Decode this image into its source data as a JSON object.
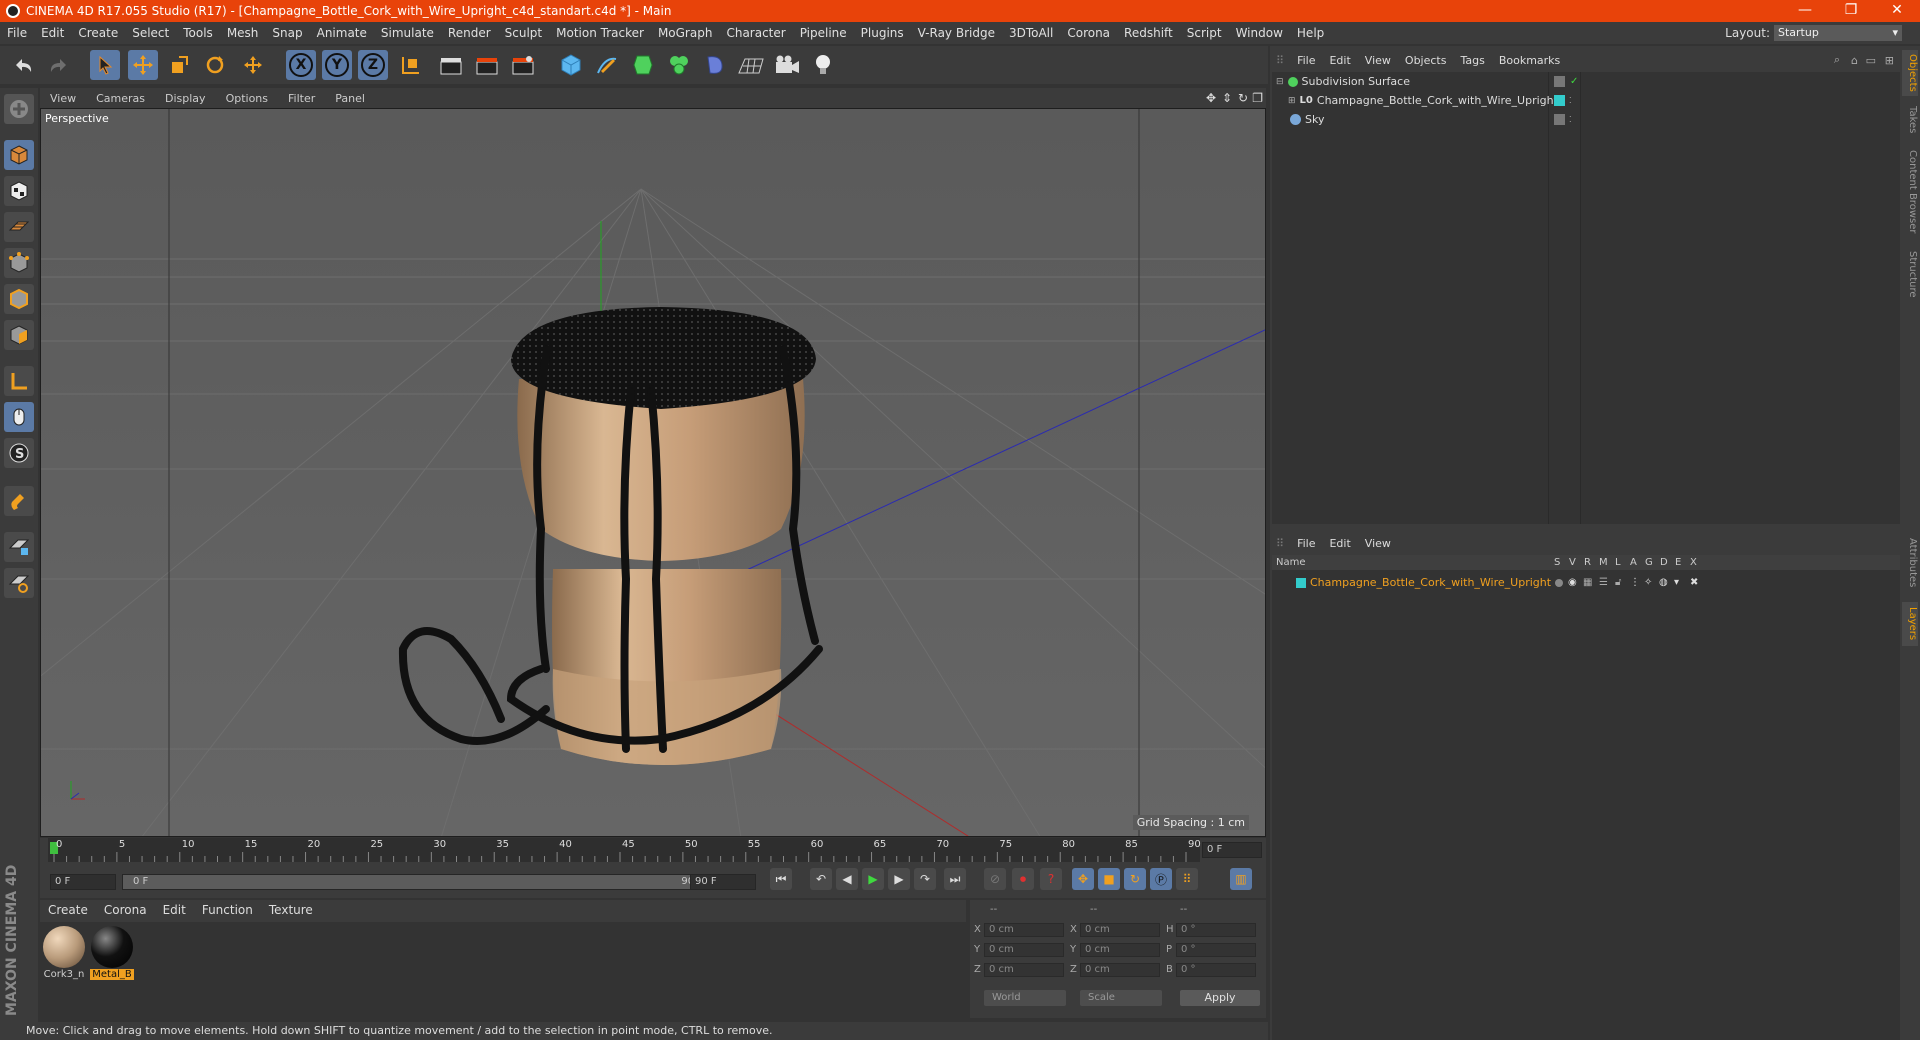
{
  "window": {
    "title": "CINEMA 4D R17.055 Studio (R17) - [Champagne_Bottle_Cork_with_Wire_Upright_c4d_standart.c4d *] - Main",
    "minimize": "—",
    "restore": "❐",
    "close": "✕"
  },
  "menubar": {
    "items": [
      "File",
      "Edit",
      "Create",
      "Select",
      "Tools",
      "Mesh",
      "Snap",
      "Animate",
      "Simulate",
      "Render",
      "Sculpt",
      "Motion Tracker",
      "MoGraph",
      "Character",
      "Pipeline",
      "Plugins",
      "V-Ray Bridge",
      "3DToAll",
      "Corona",
      "Redshift",
      "Script",
      "Window",
      "Help"
    ],
    "layout_label": "Layout:",
    "layout_value": "Startup"
  },
  "toolbar": {
    "axis_x": "X",
    "axis_y": "Y",
    "axis_z": "Z"
  },
  "viewport": {
    "menu": [
      "View",
      "Cameras",
      "Display",
      "Options",
      "Filter",
      "Panel"
    ],
    "label": "Perspective",
    "grid_spacing": "Grid Spacing : 1 cm"
  },
  "timeline": {
    "ticks": [
      "0",
      "5",
      "10",
      "15",
      "20",
      "25",
      "30",
      "35",
      "40",
      "45",
      "50",
      "55",
      "60",
      "65",
      "70",
      "75",
      "80",
      "85",
      "90"
    ],
    "end_frame": "0 F",
    "current_frame": "0 F",
    "range_start": "0 F",
    "range_end": "90 F",
    "max_frame": "90 F"
  },
  "material_manager": {
    "menu": [
      "Create",
      "Corona",
      "Edit",
      "Function",
      "Texture"
    ],
    "materials": [
      {
        "name": "Cork3_n",
        "color": "#b89a7a"
      },
      {
        "name": "Metal_B",
        "color": "#111111"
      }
    ]
  },
  "coordinates": {
    "header": [
      "--",
      "--",
      "--"
    ],
    "rows": [
      {
        "a": "X",
        "av": "0 cm",
        "b": "X",
        "bv": "0 cm",
        "c": "H",
        "cv": "0 °"
      },
      {
        "a": "Y",
        "av": "0 cm",
        "b": "Y",
        "bv": "0 cm",
        "c": "P",
        "cv": "0 °"
      },
      {
        "a": "Z",
        "av": "0 cm",
        "b": "Z",
        "bv": "0 cm",
        "c": "B",
        "cv": "0 °"
      }
    ],
    "mode1": "World",
    "mode2": "Scale",
    "apply": "Apply"
  },
  "status": "Move: Click and drag to move elements. Hold down SHIFT to quantize movement / add to the selection in point mode, CTRL to remove.",
  "objects_panel": {
    "menu": [
      "File",
      "Edit",
      "View",
      "Objects",
      "Tags",
      "Bookmarks"
    ],
    "items": [
      {
        "name": "Subdivision Surface"
      },
      {
        "name": "Champagne_Bottle_Cork_with_Wire_Upright"
      },
      {
        "name": "Sky"
      }
    ]
  },
  "layers_panel": {
    "menu": [
      "File",
      "Edit",
      "View"
    ],
    "columns": [
      "Name",
      "S",
      "V",
      "R",
      "M",
      "L",
      "A",
      "G",
      "D",
      "E",
      "X"
    ],
    "layer_name": "Champagne_Bottle_Cork_with_Wire_Upright",
    "layer_color": "#33cccc"
  },
  "side_tabs": [
    "Objects",
    "Takes",
    "Content Browser",
    "Structure",
    "Attributes",
    "Layers"
  ],
  "maxon": "MAXON CINEMA 4D"
}
